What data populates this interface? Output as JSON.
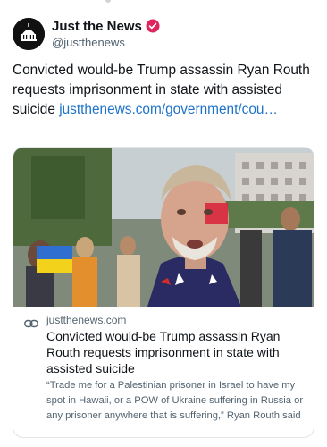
{
  "account": {
    "display_name": "Just the News",
    "handle": "@justthenews",
    "verified_icon": "verified-badge-icon",
    "verified_color": "#e0245e"
  },
  "post": {
    "text": "Convicted would-be Trump assassin Ryan Routh requests imprisonment in state with assisted suicide ",
    "link_text": "justthenews.com/government/cou…",
    "link_color": "#1d72c9"
  },
  "card": {
    "domain": "justthenews.com",
    "title": "Convicted would-be Trump assassin Ryan Routh requests imprisonment in state with assisted suicide",
    "description": "“Trade me for a Palestinian prisoner in Israel to have my spot in Hawaii, or a POW of Ukraine suffering in Russia or any prisoner anywhere that is suffering,” Ryan Routh said",
    "link_icon": "link-chain-icon"
  }
}
